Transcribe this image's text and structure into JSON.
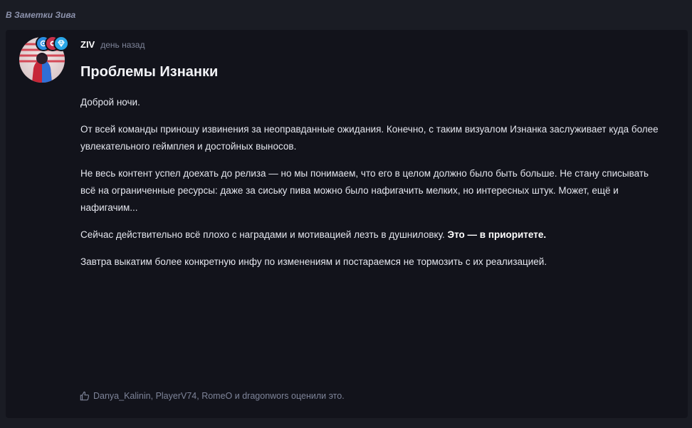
{
  "breadcrumb": {
    "label": "В Заметки Зива"
  },
  "post": {
    "author": "ZIV",
    "time": "день назад",
    "title": "Проблемы Изнанки",
    "paragraphs": [
      "Доброй ночи.",
      "От всей команды приношу извинения за неоправданные ожидания. Конечно, с таким визуалом Изнанка заслуживает куда более увлекательного геймплея и достойных выносов.",
      "Не весь контент успел доехать до релиза — но мы понимаем, что его в целом должно было быть больше. Не стану списывать всё на ограниченные ресурсы: даже за сиську пива можно было нафигачить мелких, но интересных штук. Может, ещё и нафигачим..."
    ],
    "paragraph4_plain": "Сейчас действительно всё плохо с наградами и мотивацией лезть в душниловку. ",
    "paragraph4_bold": "Это — в приоритете.",
    "paragraph5": "Завтра выкатим более конкретную инфу по изменениям и постараемся не тормозить с их реализацией."
  },
  "likes": {
    "users": [
      "Danya_Kalinin",
      "PlayerV74",
      "RomeO",
      "dragonwors"
    ],
    "sep1": ", ",
    "sep2": ", ",
    "and": " и ",
    "suffix": " оценили это."
  },
  "colors": {
    "background": "#1a1c24",
    "panel": "#12131b",
    "badge_blue": "#2a8ee0",
    "badge_red": "#c8314a"
  },
  "icons": {
    "like": "thumbs-up-icon",
    "badges": [
      "at-badge-icon",
      "circle-badge-icon",
      "diamond-badge-icon"
    ]
  }
}
